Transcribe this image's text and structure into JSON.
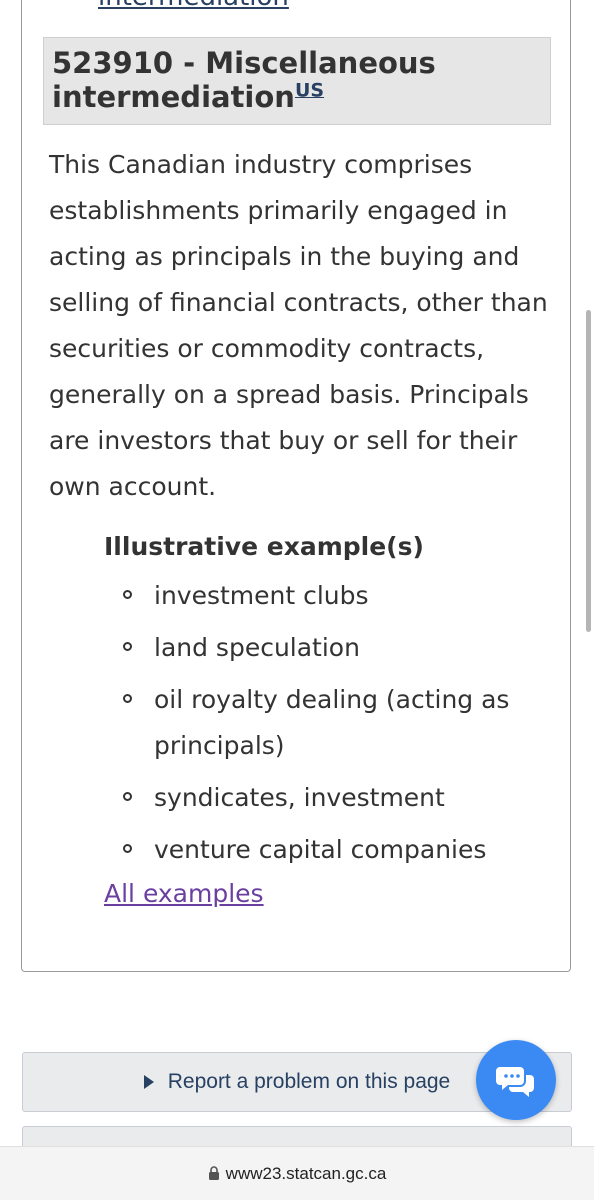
{
  "top_link_text": "intermediation",
  "panel": {
    "heading": "523910 - Miscellaneous intermediation",
    "heading_sup": "US",
    "description": "This Canadian industry comprises establishments primarily engaged in acting as principals in the buying and selling of financial contracts, other than securities or commodity contracts, generally on a spread basis. Principals are investors that buy or sell for their own account.",
    "examples_heading": "Illustrative example(s)",
    "examples": [
      "investment clubs",
      "land speculation",
      "oil royalty dealing (acting as principals)",
      "syndicates, investment",
      "venture capital companies"
    ],
    "all_examples_link": "All examples"
  },
  "footer": {
    "report_problem_label": "Report a problem on this page"
  },
  "chat_button": {
    "icon": "chat-bubbles-icon",
    "color": "#3b8af4"
  },
  "browser": {
    "url": "www23.statcan.gc.ca",
    "lock_icon": "lock-icon"
  },
  "colors": {
    "link": "#284162",
    "visited_link": "#6b3fa0",
    "heading_bg": "#e6e6e6"
  }
}
